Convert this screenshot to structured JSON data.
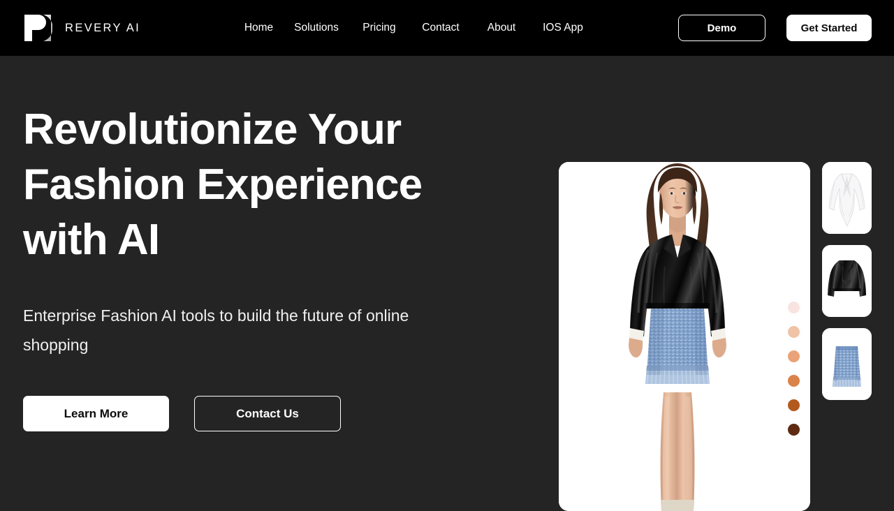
{
  "brand": {
    "name": "REVERY AI",
    "logo_icon": "revery-r-logo-icon"
  },
  "nav": {
    "items": [
      {
        "label": "Home"
      },
      {
        "label": "Solutions"
      },
      {
        "label": "Pricing"
      },
      {
        "label": "Contact"
      },
      {
        "label": "About"
      },
      {
        "label": "IOS App"
      }
    ],
    "demo_label": "Demo",
    "get_started_label": "Get Started"
  },
  "hero": {
    "headline": "Revolutionize Your Fashion Experience with AI",
    "subheadline": "Enterprise Fashion AI tools to build the future of online shopping",
    "learn_more_label": "Learn More",
    "contact_us_label": "Contact Us"
  },
  "viewer": {
    "model_alt": "fashion-model-wearing-black-leather-jacket-white-blouse-blue-tweed-skirt",
    "skin_tones": [
      {
        "name": "skin-tone-1-porcelain",
        "color": "#f9e3e0"
      },
      {
        "name": "skin-tone-2-light",
        "color": "#f0c3a6"
      },
      {
        "name": "skin-tone-3-medium-light",
        "color": "#eaa378"
      },
      {
        "name": "skin-tone-4-medium",
        "color": "#d9824a"
      },
      {
        "name": "skin-tone-5-tan",
        "color": "#b25a1e"
      },
      {
        "name": "skin-tone-6-deep",
        "color": "#5e2a11"
      }
    ],
    "thumbnails": [
      {
        "name": "thumbnail-white-bodysuit-blouse",
        "label": "White Bodysuit"
      },
      {
        "name": "thumbnail-black-cropped-leather-jacket",
        "label": "Black Cropped Leather Jacket"
      },
      {
        "name": "thumbnail-blue-tweed-fringe-skirt",
        "label": "Blue Tweed Fringe Skirt"
      }
    ]
  },
  "colors": {
    "header_bg": "#000000",
    "page_bg": "#242424",
    "accent_white": "#ffffff",
    "text_primary": "#ffffff"
  }
}
